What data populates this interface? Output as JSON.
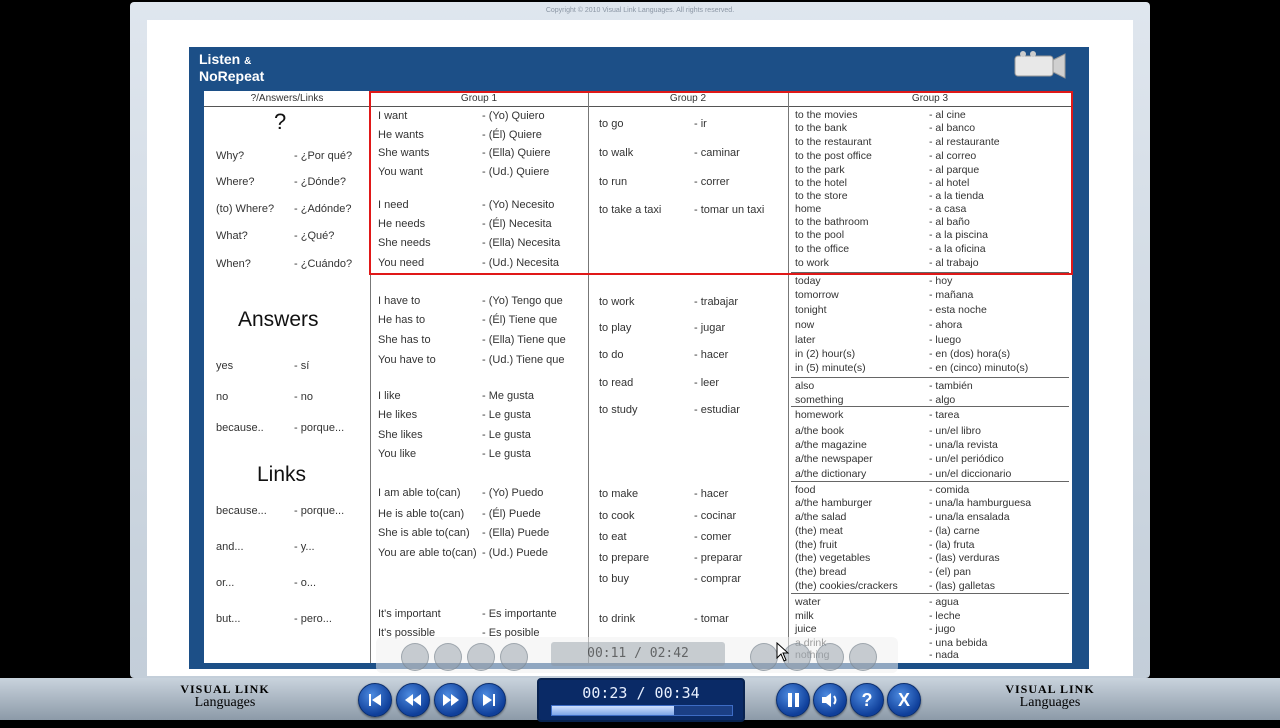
{
  "frame": {
    "copyright": "Copyright © 2010 Visual Link Languages. All rights reserved."
  },
  "logo": {
    "line1": "Listen",
    "amp": "&",
    "line2": "NoRepeat"
  },
  "vocab": {
    "col_headers": [
      "?/Answers/Links",
      "Group 1",
      "Group 2",
      "Group 3"
    ],
    "question_mark": "?",
    "questions": [
      {
        "en": "Why?",
        "es": "- ¿Por qué?"
      },
      {
        "en": "Where?",
        "es": "- ¿Dónde?"
      },
      {
        "en": "(to) Where?",
        "es": "- ¿Adónde?"
      },
      {
        "en": "What?",
        "es": "- ¿Qué?"
      },
      {
        "en": "When?",
        "es": "- ¿Cuándo?"
      }
    ],
    "answers_title": "Answers",
    "answers": [
      {
        "en": "yes",
        "es": "- sí"
      },
      {
        "en": "no",
        "es": "- no"
      },
      {
        "en": "because..",
        "es": "- porque..."
      }
    ],
    "links_title": "Links",
    "links": [
      {
        "en": "because...",
        "es": "- porque..."
      },
      {
        "en": "and...",
        "es": "- y..."
      },
      {
        "en": "or...",
        "es": "- o..."
      },
      {
        "en": "but...",
        "es": "- pero..."
      }
    ],
    "group1": [
      {
        "en": "I want",
        "es": "- (Yo) Quiero"
      },
      {
        "en": "He wants",
        "es": "- (Él) Quiere"
      },
      {
        "en": "She wants",
        "es": "- (Ella) Quiere"
      },
      {
        "en": "You want",
        "es": "- (Ud.) Quiere"
      },
      {
        "en": "I need",
        "es": "- (Yo) Necesito"
      },
      {
        "en": "He needs",
        "es": "- (Él) Necesita"
      },
      {
        "en": "She needs",
        "es": "- (Ella) Necesita"
      },
      {
        "en": "You need",
        "es": "- (Ud.) Necesita"
      },
      {
        "en": "I have to",
        "es": "- (Yo) Tengo que"
      },
      {
        "en": "He has to",
        "es": "- (Él) Tiene que"
      },
      {
        "en": "She has to",
        "es": "- (Ella) Tiene que"
      },
      {
        "en": "You have to",
        "es": "- (Ud.) Tiene que"
      },
      {
        "en": "I like",
        "es": "- Me gusta"
      },
      {
        "en": "He likes",
        "es": "- Le gusta"
      },
      {
        "en": "She likes",
        "es": "- Le gusta"
      },
      {
        "en": "You like",
        "es": "- Le gusta"
      },
      {
        "en": "I am able to(can)",
        "es": "- (Yo) Puedo"
      },
      {
        "en": "He is able to(can)",
        "es": "- (Él) Puede"
      },
      {
        "en": "She is able to(can)",
        "es": "- (Ella) Puede"
      },
      {
        "en": "You are able to(can)",
        "es": "- (Ud.) Puede"
      },
      {
        "en": "It's important",
        "es": "- Es importante"
      },
      {
        "en": "It's possible",
        "es": "- Es posible"
      }
    ],
    "group2": [
      {
        "en": "to go",
        "es": "- ir"
      },
      {
        "en": "to walk",
        "es": "- caminar"
      },
      {
        "en": "to run",
        "es": "- correr"
      },
      {
        "en": "to take a taxi",
        "es": "- tomar un taxi"
      },
      {
        "en": "to work",
        "es": "- trabajar"
      },
      {
        "en": "to play",
        "es": "- jugar"
      },
      {
        "en": "to do",
        "es": "- hacer"
      },
      {
        "en": "to read",
        "es": "- leer"
      },
      {
        "en": "to study",
        "es": "- estudiar"
      },
      {
        "en": "to make",
        "es": "- hacer"
      },
      {
        "en": "to cook",
        "es": "- cocinar"
      },
      {
        "en": "to eat",
        "es": "- comer"
      },
      {
        "en": "to prepare",
        "es": "- preparar"
      },
      {
        "en": "to buy",
        "es": "- comprar"
      },
      {
        "en": "to drink",
        "es": "- tomar"
      }
    ],
    "group3": [
      {
        "en": "to the movies",
        "es": "- al cine"
      },
      {
        "en": "to the bank",
        "es": "- al banco"
      },
      {
        "en": "to the restaurant",
        "es": "- al restaurante"
      },
      {
        "en": "to the post office",
        "es": "- al correo"
      },
      {
        "en": "to the park",
        "es": "- al parque"
      },
      {
        "en": "to the hotel",
        "es": "- al hotel"
      },
      {
        "en": "to the store",
        "es": "- a la tienda"
      },
      {
        "en": "home",
        "es": "- a casa"
      },
      {
        "en": "to the bathroom",
        "es": "- al baño"
      },
      {
        "en": "to the pool",
        "es": "- a la piscina"
      },
      {
        "en": "to the office",
        "es": "- a la oficina"
      },
      {
        "en": "to work",
        "es": "- al trabajo"
      },
      {
        "en": "today",
        "es": "- hoy"
      },
      {
        "en": "tomorrow",
        "es": "- mañana"
      },
      {
        "en": "tonight",
        "es": "- esta noche"
      },
      {
        "en": "now",
        "es": "- ahora"
      },
      {
        "en": "later",
        "es": "- luego"
      },
      {
        "en": "in (2) hour(s)",
        "es": "- en (dos) hora(s)"
      },
      {
        "en": "in (5) minute(s)",
        "es": "- en (cinco) minuto(s)"
      },
      {
        "en": "also",
        "es": "- también"
      },
      {
        "en": "something",
        "es": "- algo"
      },
      {
        "en": "homework",
        "es": "- tarea"
      },
      {
        "en": "a/the book",
        "es": "- un/el libro"
      },
      {
        "en": "a/the magazine",
        "es": "- una/la revista"
      },
      {
        "en": "a/the newspaper",
        "es": "- un/el periódico"
      },
      {
        "en": "a/the dictionary",
        "es": "- un/el diccionario"
      },
      {
        "en": "food",
        "es": "- comida"
      },
      {
        "en": "a/the hamburger",
        "es": "- una/la hamburguesa"
      },
      {
        "en": "a/the salad",
        "es": "- una/la ensalada"
      },
      {
        "en": "(the) meat",
        "es": "- (la) carne"
      },
      {
        "en": "(the) fruit",
        "es": "- (la) fruta"
      },
      {
        "en": "(the) vegetables",
        "es": "- (las) verduras"
      },
      {
        "en": "(the) bread",
        "es": "- (el) pan"
      },
      {
        "en": "(the) cookies/crackers",
        "es": "- (las) galletas"
      },
      {
        "en": "water",
        "es": "- agua"
      },
      {
        "en": "milk",
        "es": "- leche"
      },
      {
        "en": "juice",
        "es": "- jugo"
      },
      {
        "en": "a drink",
        "es": "- una bebida"
      },
      {
        "en": "nothing",
        "es": "- nada"
      }
    ]
  },
  "overlay_player": {
    "time": "00:11 / 02:42"
  },
  "player": {
    "brand_left_line1": "VISUAL LINK",
    "brand_left_line2": "Languages",
    "brand_right_line1": "VISUAL LINK",
    "brand_right_line2": "Languages",
    "time": "00:23 / 00:34",
    "progress": 0.68,
    "prev_icon": "skip-back-icon",
    "rewind_icon": "rewind-icon",
    "forward_icon": "fast-forward-icon",
    "next_icon": "skip-forward-icon",
    "pause_icon": "pause-icon",
    "volume_icon": "volume-icon",
    "help_label": "?",
    "close_label": "X",
    "accent": "#1a4fb5"
  }
}
